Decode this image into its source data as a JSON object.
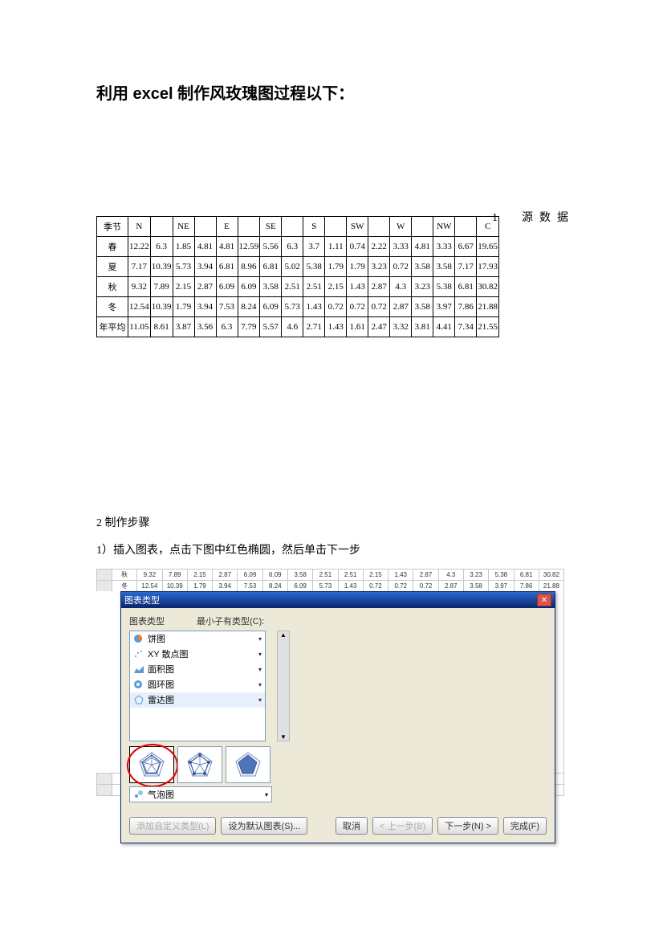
{
  "title": "利用 excel 制作风玫瑰图过程以下：",
  "section1": "1　源数据",
  "section2": "2 制作步骤",
  "step1": "1）插入图表，点击下图中红色椭圆，然后单击下一步",
  "table": {
    "headers": [
      "季节",
      "N",
      "",
      "NE",
      "",
      "E",
      "",
      "SE",
      "",
      "S",
      "",
      "SW",
      "",
      "W",
      "",
      "NW",
      "",
      "C"
    ],
    "rows": [
      [
        "春",
        "12.22",
        "6.3",
        "1.85",
        "4.81",
        "4.81",
        "12.59",
        "5.56",
        "6.3",
        "3.7",
        "1.11",
        "0.74",
        "2.22",
        "3.33",
        "4.81",
        "3.33",
        "6.67",
        "19.65"
      ],
      [
        "夏",
        "7.17",
        "10.39",
        "5.73",
        "3.94",
        "6.81",
        "8.96",
        "6.81",
        "5.02",
        "5.38",
        "1.79",
        "1.79",
        "3.23",
        "0.72",
        "3.58",
        "3.58",
        "7.17",
        "17.93"
      ],
      [
        "秋",
        "9.32",
        "7.89",
        "2.15",
        "2.87",
        "6.09",
        "6.09",
        "3.58",
        "2.51",
        "2.51",
        "2.15",
        "1.43",
        "2.87",
        "4.3",
        "3.23",
        "5.38",
        "6.81",
        "30.82"
      ],
      [
        "冬",
        "12.54",
        "10.39",
        "1.79",
        "3.94",
        "7.53",
        "8.24",
        "6.09",
        "5.73",
        "1.43",
        "0.72",
        "0.72",
        "0.72",
        "2.87",
        "3.58",
        "3.97",
        "7.86",
        "21.88"
      ],
      [
        "年平均",
        "11.05",
        "8.61",
        "3.87",
        "3.56",
        "6.3",
        "7.79",
        "5.57",
        "4.6",
        "2.71",
        "1.43",
        "1.61",
        "2.47",
        "3.32",
        "3.81",
        "4.41",
        "7.34",
        "21.55"
      ]
    ]
  },
  "ss_rows": [
    [
      "秋",
      "9.32",
      "7.89",
      "2.15",
      "2.87",
      "6.09",
      "6.09",
      "3.58",
      "2.51",
      "2.51",
      "2.15",
      "1.43",
      "2.87",
      "4.3",
      "3.23",
      "5.38",
      "6.81",
      "30.82"
    ],
    [
      "冬",
      "12.54",
      "10.39",
      "1.79",
      "3.94",
      "7.53",
      "8.24",
      "6.09",
      "5.73",
      "1.43",
      "0.72",
      "0.72",
      "0.72",
      "2.87",
      "3.58",
      "3.97",
      "7.86",
      "21.88"
    ]
  ],
  "dialog": {
    "title": "图表类型",
    "label_left": "图表类型",
    "label_right": "最小子有类型(C):",
    "types": [
      "饼图",
      "XY 散点图",
      "面积图",
      "圆环图",
      "雷达图"
    ],
    "bubble": "气泡图",
    "btn_custom": "添加自定义类型(L)",
    "btn_default": "设为默认图表(S)...",
    "btn_cancel": "取消",
    "btn_prev": "< 上一步(B)",
    "btn_next": "下一步(N) >",
    "btn_finish": "完成(F)"
  }
}
